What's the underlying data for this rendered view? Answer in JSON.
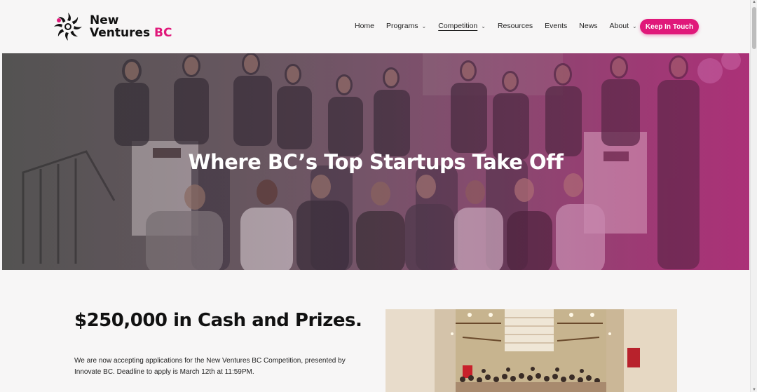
{
  "brand": {
    "name_line1": "New",
    "name_line2": "Ventures",
    "name_accent": "BC",
    "accent_color": "#e0187a"
  },
  "nav": {
    "items": [
      {
        "label": "Home",
        "has_dropdown": false
      },
      {
        "label": "Programs",
        "has_dropdown": true
      },
      {
        "label": "Competition",
        "has_dropdown": true,
        "active": true
      },
      {
        "label": "Resources",
        "has_dropdown": false
      },
      {
        "label": "Events",
        "has_dropdown": false
      },
      {
        "label": "News",
        "has_dropdown": false
      },
      {
        "label": "About",
        "has_dropdown": true
      }
    ],
    "cta_label": "Keep In Touch"
  },
  "hero": {
    "title": "Where BC’s Top Startups Take Off",
    "image_icon": "group-photo"
  },
  "main": {
    "headline": "$250,000 in Cash and Prizes.",
    "body": "We are now accepting applications for the New Ventures BC Competition, presented by Innovate BC. Deadline to apply is March 12th at 11:59PM.",
    "photo_icon": "atrium-group-photo"
  }
}
